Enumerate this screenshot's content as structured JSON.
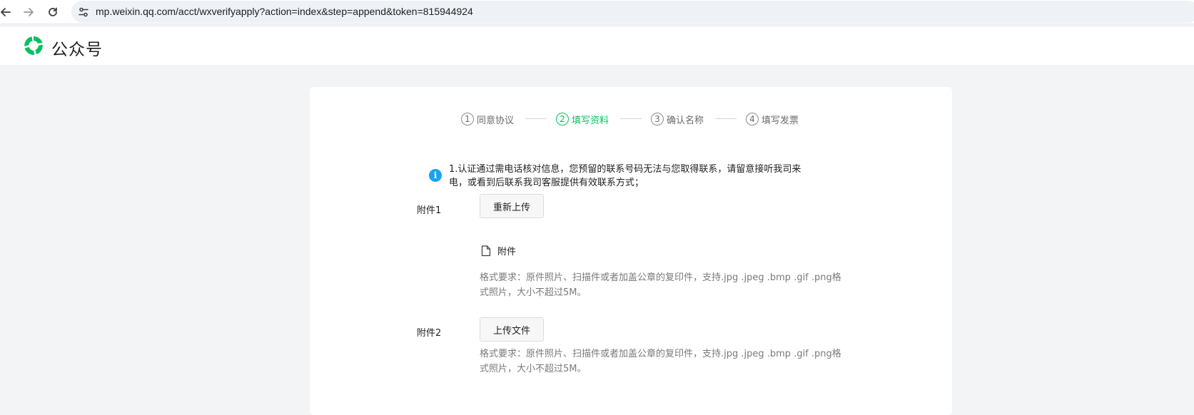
{
  "browser": {
    "url": "mp.weixin.qq.com/acct/wxverifyapply?action=index&step=append&token=815944924"
  },
  "header": {
    "logo_text": "公众号"
  },
  "stepper": {
    "steps": [
      {
        "num": "1",
        "label": "同意协议"
      },
      {
        "num": "2",
        "label": "填写资料"
      },
      {
        "num": "3",
        "label": "确认名称"
      },
      {
        "num": "4",
        "label": "填写发票"
      }
    ],
    "active_index": 1
  },
  "notice": {
    "icon": "i",
    "text": "1.认证通过需电话核对信息，您预留的联系号码无法与您取得联系，请留意接听我司来电，或看到后联系我司客服提供有效联系方式；"
  },
  "form": {
    "attachment1": {
      "label": "附件1",
      "button_label": "重新上传",
      "file_name": "附件",
      "hint": "格式要求：原件照片、扫描件或者加盖公章的复印件，支持.jpg .jpeg .bmp .gif .png格式照片，大小不超过5M。"
    },
    "attachment2": {
      "label": "附件2",
      "button_label": "上传文件",
      "hint": "格式要求：原件照片、扫描件或者加盖公章的复印件，支持.jpg .jpeg .bmp .gif .png格式照片，大小不超过5M。"
    }
  },
  "colors": {
    "accent": "#07c160",
    "info": "#1aa3f0",
    "page_bg": "#f3f4f6"
  }
}
